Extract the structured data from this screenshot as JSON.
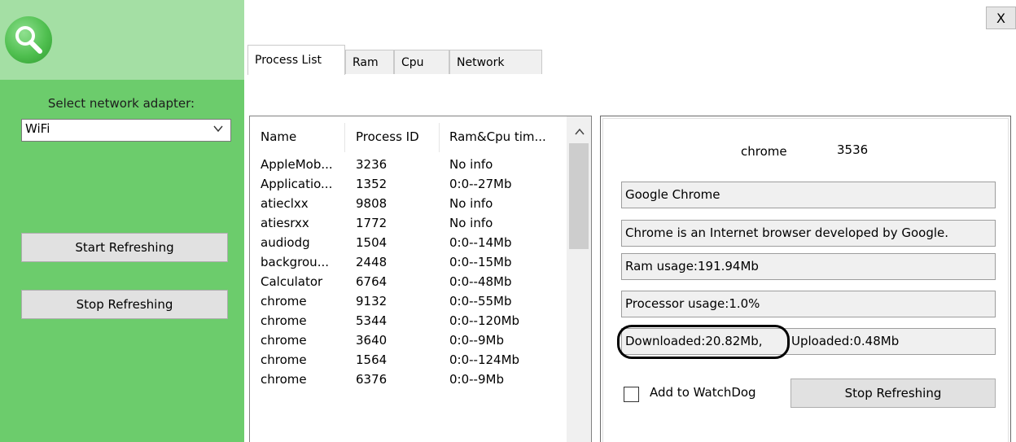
{
  "sidebar": {
    "adapter_label": "Select network adapter:",
    "adapter_selected": "WiFi",
    "start_button": "Start Refreshing",
    "stop_button": "Stop Refreshing"
  },
  "window": {
    "close_label": "X"
  },
  "tabs": [
    {
      "label": "Process List",
      "active": true
    },
    {
      "label": "Ram"
    },
    {
      "label": "Cpu"
    },
    {
      "label": "Network"
    }
  ],
  "process_list": {
    "columns": [
      "Name",
      "Process ID",
      "Ram&Cpu tim..."
    ],
    "rows": [
      [
        "AppleMob...",
        "3236",
        "No info"
      ],
      [
        "Applicatio...",
        "1352",
        "0:0--27Mb"
      ],
      [
        "atieclxx",
        "9808",
        "No info"
      ],
      [
        "atiesrxx",
        "1772",
        "No info"
      ],
      [
        "audiodg",
        "1504",
        "0:0--14Mb"
      ],
      [
        "backgrou...",
        "2448",
        "0:0--15Mb"
      ],
      [
        "Calculator",
        "6764",
        "0:0--48Mb"
      ],
      [
        "chrome",
        "9132",
        "0:0--55Mb"
      ],
      [
        "chrome",
        "5344",
        "0:0--120Mb"
      ],
      [
        "chrome",
        "3640",
        "0:0--9Mb"
      ],
      [
        "chrome",
        "1564",
        "0:0--124Mb"
      ],
      [
        "chrome",
        "6376",
        "0:0--9Mb"
      ]
    ]
  },
  "details": {
    "name": "chrome",
    "pid": "3536",
    "title": "Google Chrome",
    "description": "Chrome is an Internet browser developed by Google.",
    "ram_usage": "Ram usage:191.94Mb",
    "processor_usage": "Processor usage:1.0%",
    "downloaded": "Downloaded:20.82Mb,",
    "uploaded": "Uploaded:0.48Mb",
    "watchdog_label": "Add to WatchDog",
    "stop_button": "Stop Refreshing"
  },
  "icons": {
    "logo": "search-icon",
    "dropdown": "chevron-down-icon",
    "scroll_up": "chevron-up-icon"
  },
  "colors": {
    "sidebar": "#6ccc6c",
    "sidebar_header": "#a4dfa4"
  }
}
